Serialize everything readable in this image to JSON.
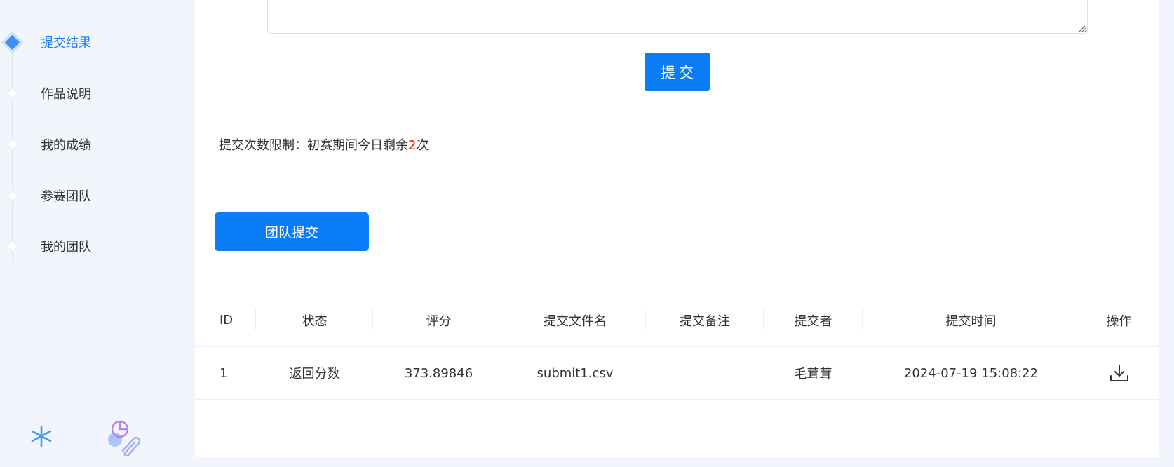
{
  "sidebar": {
    "items": [
      {
        "label": "提交结果",
        "active": true
      },
      {
        "label": "作品说明",
        "active": false
      },
      {
        "label": "我的成绩",
        "active": false
      },
      {
        "label": "参赛团队",
        "active": false
      },
      {
        "label": "我的团队",
        "active": false
      }
    ],
    "accent_color": "#1a7ef5"
  },
  "submit_form": {
    "textarea_value": "",
    "submit_label": "提交",
    "limit_prefix": "提交次数限制：初赛期间今日剩余",
    "limit_count": "2",
    "limit_suffix": "次"
  },
  "team_submit": {
    "label": "团队提交"
  },
  "table": {
    "columns": [
      "ID",
      "状态",
      "评分",
      "提交文件名",
      "提交备注",
      "提交者",
      "提交时间",
      "操作"
    ],
    "rows": [
      {
        "id": "1",
        "status": "返回分数",
        "score": "373.89846",
        "file": "submit1.csv",
        "note": "",
        "submitter": "毛茸茸",
        "time": "2024-07-19 15:08:22",
        "action_icon": "download-icon"
      }
    ]
  },
  "colors": {
    "primary": "#0a7cf8",
    "highlight_red": "#ff0000",
    "page_bg": "#f2f6fc"
  }
}
